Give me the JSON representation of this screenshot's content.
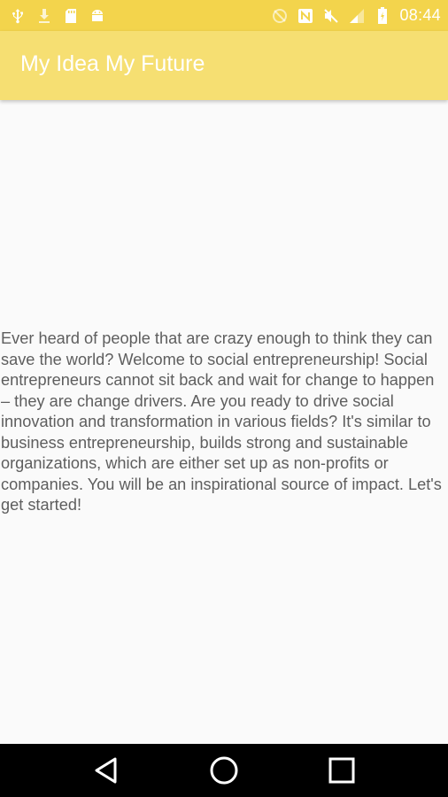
{
  "status_bar": {
    "left_icons": [
      "usb-icon",
      "download-icon",
      "sd-card-icon",
      "android-icon"
    ],
    "right_icons": [
      "sync-off-icon",
      "nfc-icon",
      "mute-icon",
      "signal-icon",
      "battery-icon"
    ],
    "time": "08:44"
  },
  "app_bar": {
    "title": "My Idea My Future"
  },
  "main": {
    "description": "Ever heard of people that are crazy enough to think they can save the world? Welcome to social entrepreneurship! Social entrepreneurs cannot sit back and wait for change to happen – they are change drivers. Are you ready to drive social innovation and transformation in various fields? It's similar to business entrepreneurship, builds strong and sustainable organizations, which are either set up as non-profits or companies. You will be an inspirational source of impact. Let's get started!"
  },
  "nav_bar": {
    "buttons": [
      "back-icon",
      "home-icon",
      "recents-icon"
    ]
  },
  "colors": {
    "status_bar": "#f3d44c",
    "app_bar": "#f6df72",
    "background": "#fafafa",
    "text": "#5e5e5e",
    "nav_bar": "#000000"
  }
}
